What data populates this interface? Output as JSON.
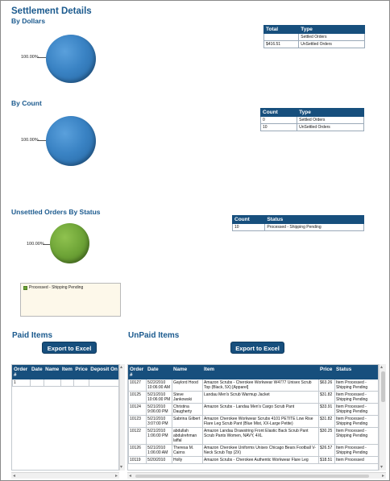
{
  "header": {
    "title": "Settlement Details",
    "by_dollars": "By Dollars",
    "by_count": "By Count",
    "unsettled_by_status": "Unsettled Orders By Status"
  },
  "pies": {
    "dollars_label": "100.00%",
    "count_label": "100.00%",
    "status_label": "100.00%",
    "colors": {
      "blue": "#3a83c4",
      "green": "#6ea437"
    }
  },
  "dollars_table": {
    "headers": [
      "Total",
      "Type"
    ],
    "rows": [
      [
        "",
        "Settled Orders"
      ],
      [
        "$416.51",
        "UnSettled Orders"
      ]
    ]
  },
  "count_table": {
    "headers": [
      "Count",
      "Type"
    ],
    "rows": [
      [
        "0",
        "Settled Orders"
      ],
      [
        "10",
        "UnSettled Orders"
      ]
    ]
  },
  "status_table": {
    "headers": [
      "Count",
      "Status"
    ],
    "rows": [
      [
        "10",
        "Processed - Shipping Pending"
      ]
    ]
  },
  "legend": {
    "item": "Processed - Shipping Pending"
  },
  "paid": {
    "title": "Paid Items",
    "export_label": "Export to Excel",
    "headers": [
      "Order #",
      "Date",
      "Name",
      "Item",
      "Price",
      "Deposit On"
    ],
    "rows": [
      [
        "1",
        "",
        "",
        "",
        "",
        ""
      ]
    ]
  },
  "unpaid": {
    "title": "UnPaid Items",
    "export_label": "Export to Excel",
    "headers": [
      "Order #",
      "Date",
      "Name",
      "Item",
      "Price",
      "Status"
    ],
    "rows": [
      [
        "10127",
        "5/22/2010 10:06:00 AM",
        "Gaylord Hood",
        "Amazon Scrubs - Cherokee Workwear W4777 Unisex Scrub Top (Black, 5X) [Apparel]",
        "$63.26",
        "Item Processed - Shipping Pending"
      ],
      [
        "10125",
        "5/21/2010 10:06:00 PM",
        "Steve Jankowski",
        "Landau Men's Scrub Warmup Jacket",
        "$31.82",
        "Item Processed - Shipping Pending"
      ],
      [
        "10124",
        "5/21/2010 9:06:00 PM",
        "Christina Daugherty",
        "Amazon Scrubs - Landau Men's Cargo Scrub Pant",
        "$33.91",
        "Item Processed - Shipping Pending"
      ],
      [
        "10123",
        "5/21/2010 3:07:00 PM",
        "Sabrina Gilbert",
        "Amazon Cherokee Workwear Scrubs 4101 PETITE Low Rise Flare Leg Scrub Pant (Blue Mist, XX-Large Petite)",
        "$31.82",
        "Item Processed - Shipping Pending"
      ],
      [
        "10122",
        "5/21/2010 1:06:00 PM",
        "abdullah abdulrehman laffal",
        "Amazon Landau Drawstring Front Elastic Back Scrub Pant Scrub Pants Women, NAVY, 4XL",
        "$30.25",
        "Item Processed - Shipping Pending"
      ],
      [
        "10126",
        "5/21/2010 1:06:00 AM",
        "Theresa M. Cairns",
        "Amazon Cherokee Uniforms Unisex Chicago Bears Football V-Neck Scrub Top (2X)",
        "$26.57",
        "Item Processed - Shipping Pending"
      ],
      [
        "10119",
        "5/20/2010",
        "Holly",
        "Amazon Scrubs - Cherokee Authentic Workwear Flare Leg",
        "$18.51",
        "Item Processed"
      ]
    ]
  }
}
